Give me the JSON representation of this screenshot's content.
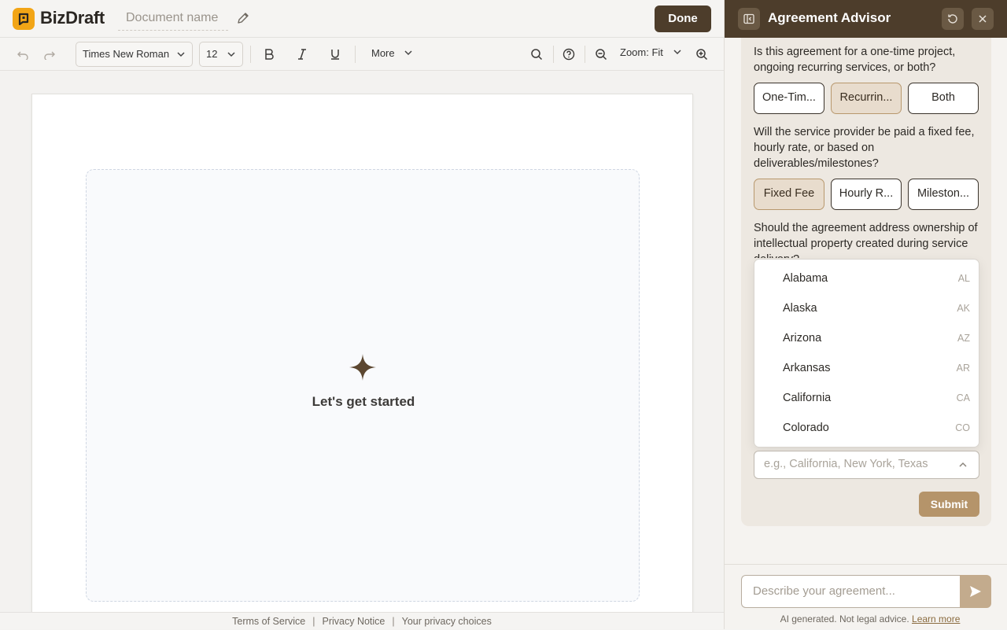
{
  "app": {
    "brand": "BizDraft",
    "document_name_placeholder": "Document name",
    "done_label": "Done"
  },
  "toolbar": {
    "font_family": "Times New Roman",
    "font_size": "12",
    "more_label": "More",
    "zoom_label": "Zoom: Fit"
  },
  "canvas": {
    "empty_title": "Let's get started"
  },
  "footer": {
    "links": [
      "Terms of Service",
      "Privacy Notice",
      "Your privacy choices"
    ]
  },
  "advisor": {
    "title": "Agreement Advisor",
    "q1": "Is this agreement for a one-time project, ongoing recurring services, or both?",
    "q1_options": [
      "One-Tim...",
      "Recurrin...",
      "Both"
    ],
    "q1_selected": 1,
    "q2": "Will the service provider be paid a fixed fee, hourly rate, or based on deliverables/milestones?",
    "q2_options": [
      "Fixed Fee",
      "Hourly R...",
      "Mileston..."
    ],
    "q2_selected": 0,
    "q3": "Should the agreement address ownership of intellectual property created during service delivery?",
    "states": [
      {
        "name": "Alabama",
        "abbr": "AL"
      },
      {
        "name": "Alaska",
        "abbr": "AK"
      },
      {
        "name": "Arizona",
        "abbr": "AZ"
      },
      {
        "name": "Arkansas",
        "abbr": "AR"
      },
      {
        "name": "California",
        "abbr": "CA"
      },
      {
        "name": "Colorado",
        "abbr": "CO"
      }
    ],
    "state_placeholder": "e.g., California, New York, Texas",
    "submit_label": "Submit",
    "describe_placeholder": "Describe your agreement...",
    "disclaimer": "AI generated. Not legal advice.",
    "learn_more": "Learn more"
  },
  "colors": {
    "brand_yellow": "#f2a516",
    "header_brown": "#4d3d2b",
    "accent_tan": "#b5946a"
  }
}
